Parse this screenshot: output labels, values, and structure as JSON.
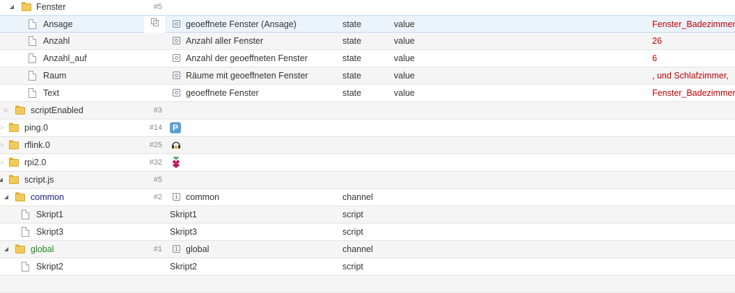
{
  "rows": [
    {
      "name": "Fenster",
      "count": "#5"
    },
    {
      "name": "Ansage",
      "desc": "geoeffnete Fenster (Ansage)",
      "type": "state",
      "role": "value",
      "value": "Fenster_Badezimmer"
    },
    {
      "name": "Anzahl",
      "desc": "Anzahl aller Fenster",
      "type": "state",
      "role": "value",
      "value": "26"
    },
    {
      "name": "Anzahl_auf",
      "desc": "Anzahl der geoeffneten Fenster",
      "type": "state",
      "role": "value",
      "value": "6"
    },
    {
      "name": "Raum",
      "desc": "Räume mit geoeffneten Fenster",
      "type": "state",
      "role": "value",
      "value": ", und Schlafzimmer,"
    },
    {
      "name": "Text",
      "desc": "geoeffnete Fenster",
      "type": "state",
      "role": "value",
      "value": "Fenster_Badezimmer"
    },
    {
      "name": "scriptEnabled",
      "count": "#3"
    },
    {
      "name": "ping.0",
      "count": "#14",
      "icon_text": "P"
    },
    {
      "name": "rflink.0",
      "count": "#25"
    },
    {
      "name": "rpi2.0",
      "count": "#32"
    },
    {
      "name": "script.js",
      "count": "#5"
    },
    {
      "name": "common",
      "count": "#2",
      "desc": "common",
      "type": "channel"
    },
    {
      "name": "Skript1",
      "desc": "Skript1",
      "type": "script"
    },
    {
      "name": "Skript3",
      "desc": "Skript3",
      "type": "script"
    },
    {
      "name": "global",
      "count": "#1",
      "desc": "global",
      "type": "channel"
    },
    {
      "name": "Skript2",
      "desc": "Skript2",
      "type": "script"
    }
  ],
  "colors": {
    "common_name": "#1a1a8c",
    "global_name": "#1a8c1a",
    "value": "#c00000",
    "selected_row": "#ebf3fb"
  },
  "icons": {
    "toggle_open": "triangle-down-icon",
    "toggle_closed": "triangle-right-icon",
    "folder": "folder-icon",
    "file": "file-icon",
    "state": "state-icon",
    "channel": "channel-icon",
    "copy": "copy-icon"
  }
}
